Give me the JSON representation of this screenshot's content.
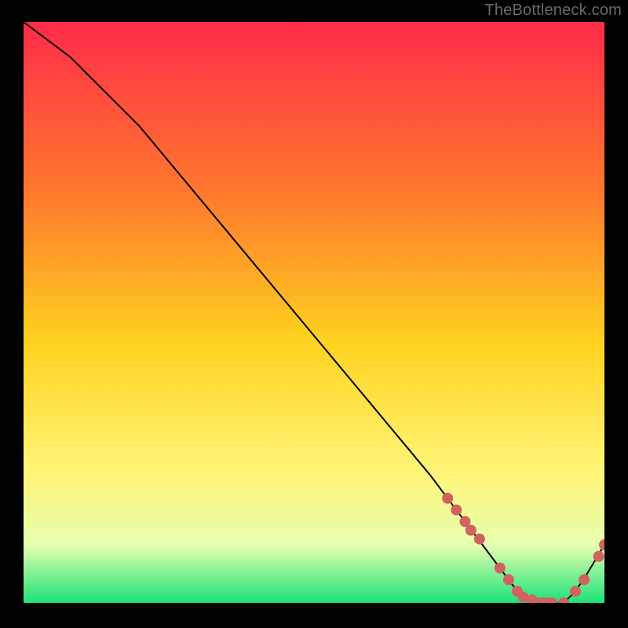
{
  "watermark": "TheBottleneck.com",
  "colors": {
    "background": "#000000",
    "gradient_top": "#ff2b4a",
    "gradient_mid1": "#ff7a2d",
    "gradient_mid2": "#ffd21f",
    "gradient_mid3": "#fff67a",
    "gradient_pale": "#e7ffb0",
    "gradient_bottom": "#1de27a",
    "curve": "#000000",
    "marker": "#d1625f"
  },
  "chart_data": {
    "type": "line",
    "title": "",
    "xlabel": "",
    "ylabel": "",
    "xlim": [
      0,
      100
    ],
    "ylim": [
      0,
      100
    ],
    "series": [
      {
        "name": "bottleneck-curve",
        "x": [
          0,
          4,
          8,
          12,
          16,
          20,
          25,
          30,
          35,
          40,
          45,
          50,
          55,
          60,
          65,
          70,
          73,
          76,
          79,
          82,
          85,
          88,
          91,
          93,
          95,
          97,
          100
        ],
        "y": [
          100,
          97,
          94,
          90,
          86,
          82,
          76,
          70,
          64,
          58,
          52,
          46,
          40,
          34,
          28,
          22,
          18,
          14,
          10,
          6,
          2,
          0,
          0,
          0,
          2,
          5,
          10
        ]
      }
    ],
    "markers": {
      "name": "highlighted-points",
      "x": [
        73,
        74.5,
        76,
        77,
        78.5,
        82,
        83.5,
        85,
        86,
        87.5,
        88.5,
        89.5,
        90.5,
        91,
        93,
        95,
        96.5,
        99,
        100
      ],
      "y": [
        18,
        16,
        14,
        12.5,
        11,
        6,
        4,
        2,
        1,
        0.5,
        0,
        0,
        0,
        0,
        0,
        2,
        4,
        8,
        10
      ]
    }
  }
}
